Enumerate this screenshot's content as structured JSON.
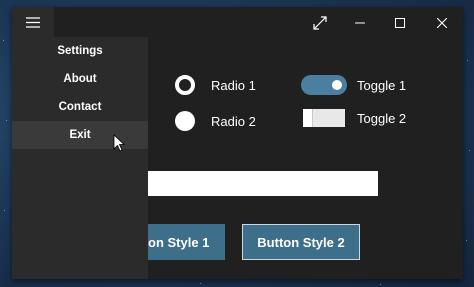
{
  "menu": {
    "items": [
      {
        "label": "Settings"
      },
      {
        "label": "About"
      },
      {
        "label": "Contact"
      },
      {
        "label": "Exit"
      }
    ]
  },
  "radios": [
    {
      "label": "Radio 1",
      "checked": true
    },
    {
      "label": "Radio 2",
      "checked": false
    }
  ],
  "toggles": [
    {
      "label": "Toggle 1",
      "on": true
    },
    {
      "label": "Toggle 2",
      "on": false
    }
  ],
  "textbox": {
    "value": ""
  },
  "buttons": {
    "style1_label": "on Style 1",
    "style2_label": "Button Style 2"
  },
  "colors": {
    "accent": "#3d6f8a",
    "toggle_on": "#4a7fa1",
    "window_bg": "#202020",
    "pane_bg": "#2b2b2b"
  },
  "icons": {
    "hamburger": "hamburger-icon",
    "fullscreen": "fullscreen-icon",
    "minimize": "minimize-icon",
    "maximize": "maximize-icon",
    "close": "close-icon",
    "cursor": "mouse-cursor-icon"
  }
}
